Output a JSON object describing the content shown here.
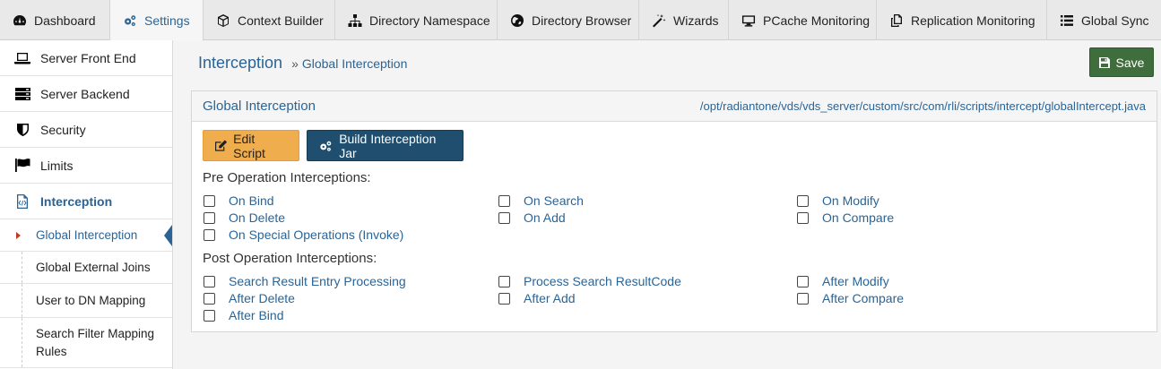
{
  "topnav": {
    "tabs": [
      {
        "label": "Dashboard",
        "icon": "dashboard-icon"
      },
      {
        "label": "Settings",
        "icon": "gears-icon",
        "active": true
      },
      {
        "label": "Context Builder",
        "icon": "cube-icon"
      },
      {
        "label": "Directory Namespace",
        "icon": "sitemap-icon"
      },
      {
        "label": "Directory Browser",
        "icon": "globe-icon"
      },
      {
        "label": "Wizards",
        "icon": "magic-wand-icon"
      },
      {
        "label": "PCache Monitoring",
        "icon": "desktop-icon"
      },
      {
        "label": "Replication Monitoring",
        "icon": "copy-icon"
      },
      {
        "label": "Global Sync",
        "icon": "list-icon"
      }
    ]
  },
  "sidebar": {
    "items": [
      {
        "label": "Server Front End",
        "icon": "laptop-icon"
      },
      {
        "label": "Server Backend",
        "icon": "server-icon"
      },
      {
        "label": "Security",
        "icon": "shield-icon"
      },
      {
        "label": "Limits",
        "icon": "flag-icon"
      },
      {
        "label": "Interception",
        "icon": "code-file-icon",
        "active": true
      }
    ],
    "subitems": [
      {
        "label": "Global Interception",
        "active": true
      },
      {
        "label": "Global External Joins"
      },
      {
        "label": "User to DN Mapping"
      },
      {
        "label": "Search Filter Mapping Rules"
      }
    ]
  },
  "breadcrumb": {
    "root": "Interception",
    "separator": "»",
    "leaf": "Global Interception"
  },
  "save_label": "Save",
  "panel": {
    "title": "Global Interception",
    "path": "/opt/radiantone/vds/vds_server/custom/src/com/rli/scripts/intercept/globalIntercept.java",
    "edit_label": "Edit Script",
    "build_label": "Build Interception Jar",
    "pre_label": "Pre Operation Interceptions:",
    "post_label": "Post Operation Interceptions:",
    "pre": [
      {
        "label": "On Bind",
        "checked": false
      },
      {
        "label": "On Search",
        "checked": false
      },
      {
        "label": "On Modify",
        "checked": false
      },
      {
        "label": "On Delete",
        "checked": false
      },
      {
        "label": "On Add",
        "checked": false
      },
      {
        "label": "On Compare",
        "checked": false
      },
      {
        "label": "On Special Operations (Invoke)",
        "checked": false
      }
    ],
    "post": [
      {
        "label": "Search Result Entry Processing",
        "checked": false
      },
      {
        "label": "Process Search ResultCode",
        "checked": false
      },
      {
        "label": "After Modify",
        "checked": false
      },
      {
        "label": "After Delete",
        "checked": false
      },
      {
        "label": "After Add",
        "checked": false
      },
      {
        "label": "After Compare",
        "checked": false
      },
      {
        "label": "After Bind",
        "checked": false
      }
    ]
  },
  "colors": {
    "link": "#2a6496",
    "save": "#3f6e3c",
    "edit": "#f0ad4e",
    "build": "#1f4e6e"
  }
}
